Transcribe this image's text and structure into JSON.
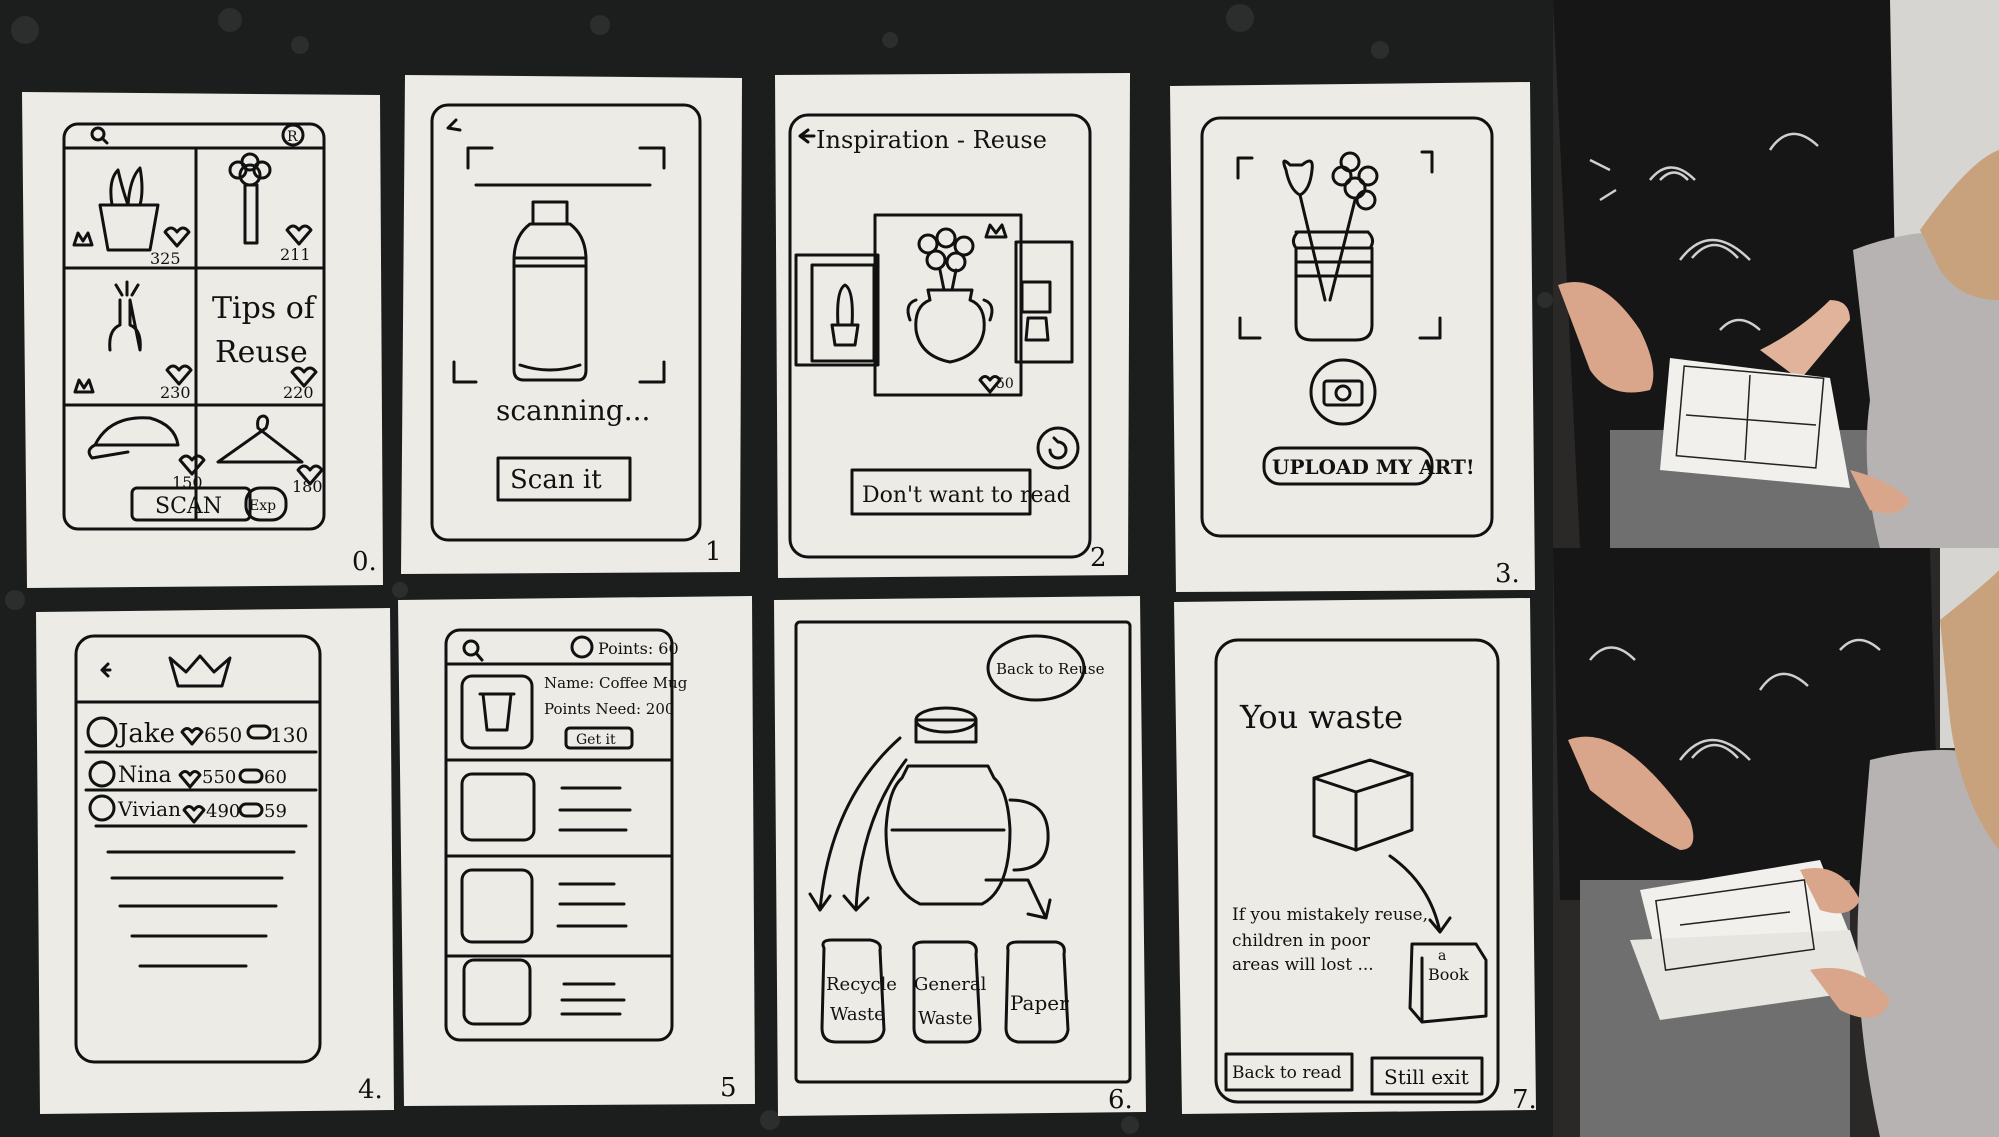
{
  "sheets": {
    "s0": {
      "number": "0.",
      "tiles": [
        {
          "count": "325"
        },
        {
          "count": "211"
        },
        {
          "count": "230"
        },
        {
          "label_line1": "Tips of",
          "label_line2": "Reuse",
          "count": "220"
        },
        {
          "count": "150"
        },
        {
          "count": "180"
        }
      ],
      "scan_label": "SCAN",
      "side_label": "Exp"
    },
    "s1": {
      "number": "1",
      "status": "scanning...",
      "button": "Scan it"
    },
    "s2": {
      "number": "2",
      "title": "Inspiration - Reuse",
      "likes": "50",
      "button": "Don't want to read"
    },
    "s3": {
      "number": "3.",
      "button": "UPLOAD MY ART!"
    },
    "s4": {
      "number": "4.",
      "rows": [
        {
          "name": "Jake",
          "likes": "650",
          "comments": "130"
        },
        {
          "name": "Nina",
          "likes": "550",
          "comments": "60"
        },
        {
          "name": "Vivian",
          "likes": "490",
          "comments": "59"
        }
      ]
    },
    "s5": {
      "number": "5",
      "points": "Points: 60",
      "item_name": "Name: Coffee Mug",
      "points_need": "Points Need: 200",
      "get_button": "Get it"
    },
    "s6": {
      "number": "6.",
      "back_button": "Back to Reuse",
      "bins": [
        {
          "l1": "Recycle",
          "l2": "Waste"
        },
        {
          "l1": "General",
          "l2": "Waste"
        },
        {
          "l1": "Paper",
          "l2": ""
        }
      ]
    },
    "s7": {
      "number": "7.",
      "headline": "You waste",
      "msg1": "If you mistakely reuse,",
      "msg2": "children in poor",
      "msg3": "areas will lost ...",
      "box_label_a": "a",
      "box_label_b": "Book",
      "back_button": "Back to read",
      "exit_button": "Still exit"
    }
  },
  "colors": {
    "background": "#1c1e1d",
    "paper": "#ecebe5",
    "ink": "#111111",
    "photo_shirt": "#161616",
    "photo_wall": "#d7d5d2"
  }
}
